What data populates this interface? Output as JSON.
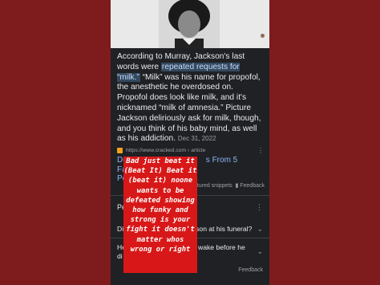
{
  "snippet": {
    "before": "According to Murray, Jackson's last words were ",
    "highlight": "repeated requests for “milk.”",
    "after": " “Milk” was his name for propofol, the anesthetic he overdosed on. Propofol does look like milk, and it's nicknamed “milk of amnesia.” Picture Jackson deliriously ask for milk, though, and you think of his baby mind, as well as his addiction.",
    "date": "Dec 31, 2022"
  },
  "source": {
    "url": "https://www.cracked.com › article",
    "menu_icon": "more-vert-icon"
  },
  "result": {
    "title_visible_start": "De",
    "title_visible_end": "s From 5 Famous",
    "title_line2_start": "Pe",
    "about_label": "eatured snippets",
    "feedback_label": "Feedback"
  },
  "people_also_ask": {
    "title_start": "Pe",
    "questions": [
      {
        "start": "Di",
        "end": "son at his funeral?"
      },
      {
        "start": "He",
        "line2_start": "di",
        "end": "wake before he"
      }
    ],
    "feedback_label": "Feedback"
  },
  "overlay": {
    "text": "Bad just beat it\n(Beat It) Beat it\n(beat it) noone\nwants to be\ndefeated showing\nhow funky and\nstrong is your\nfight it doesn't\nmatter whos\nwrong or right",
    "color": "#d81818"
  }
}
